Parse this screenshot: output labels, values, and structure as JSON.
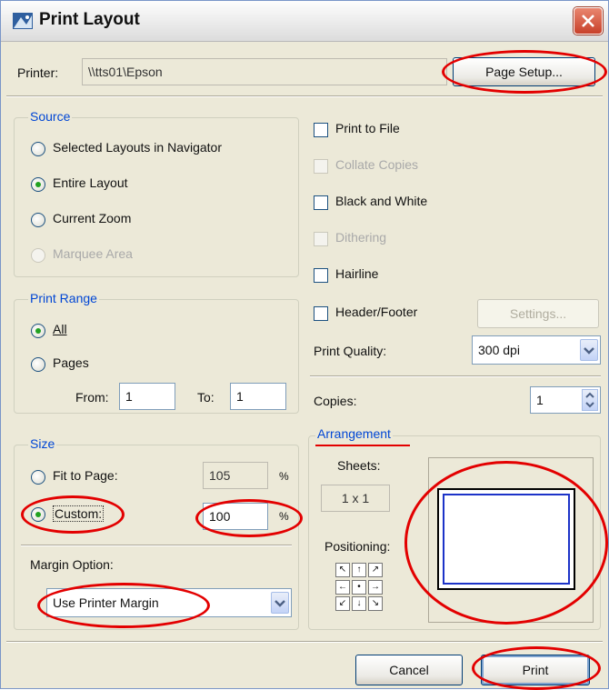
{
  "title": "Print Layout",
  "printer": {
    "label": "Printer:",
    "value": "\\\\tts01\\Epson",
    "page_setup_label": "Page Setup..."
  },
  "source": {
    "legend": "Source",
    "options": [
      "Selected Layouts in Navigator",
      "Entire Layout",
      "Current Zoom",
      "Marquee Area"
    ],
    "selected": "Entire Layout"
  },
  "options": {
    "print_to_file": "Print to File",
    "collate_copies": "Collate Copies",
    "black_and_white": "Black and White",
    "dithering": "Dithering",
    "hairline": "Hairline",
    "header_footer": "Header/Footer",
    "settings_label": "Settings..."
  },
  "quality": {
    "label": "Print Quality:",
    "value": "300 dpi"
  },
  "print_range": {
    "legend": "Print Range",
    "all_label": "All",
    "pages_label": "Pages",
    "from_label": "From:",
    "from_value": "1",
    "to_label": "To:",
    "to_value": "1"
  },
  "copies": {
    "label": "Copies:",
    "value": "1"
  },
  "size": {
    "legend": "Size",
    "fit_label": "Fit to Page:",
    "fit_value": "105",
    "custom_label": "Custom:",
    "custom_value": "100",
    "percent": "%"
  },
  "arrangement": {
    "legend": "Arrangement",
    "sheets_label": "Sheets:",
    "sheets_value": "1 x 1",
    "positioning_label": "Positioning:",
    "position_arrows": [
      "↖",
      "↑",
      "↗",
      "←",
      "•",
      "→",
      "↙",
      "↓",
      "↘"
    ]
  },
  "margin": {
    "label": "Margin Option:",
    "value": "Use Printer Margin"
  },
  "footer": {
    "cancel_label": "Cancel",
    "print_label": "Print"
  },
  "colors": {
    "legend_blue": "#0046d5",
    "annotation_red": "#e30000",
    "preview_border": "#1c33c8"
  }
}
